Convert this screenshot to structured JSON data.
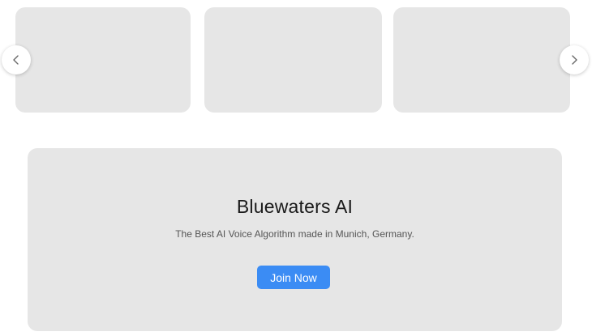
{
  "carousel": {
    "prev_icon": "chevron-left-icon",
    "next_icon": "chevron-right-icon",
    "card_color": "#e6e6e6"
  },
  "hero": {
    "title": "Bluewaters AI",
    "subtitle": "The Best AI Voice Algorithm made in Munich, Germany.",
    "button_label": "Join Now",
    "button_color": "#3b8cf4"
  }
}
